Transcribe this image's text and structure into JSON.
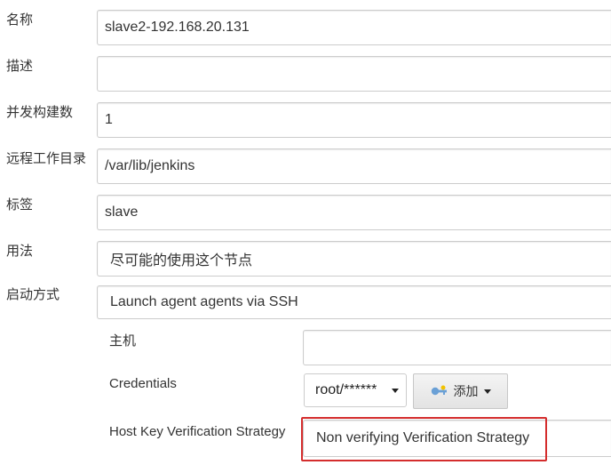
{
  "form": {
    "name": {
      "label": "名称",
      "value": "slave2-192.168.20.131"
    },
    "description": {
      "label": "描述",
      "value": ""
    },
    "executors": {
      "label": "并发构建数",
      "value": "1"
    },
    "remote_dir": {
      "label": "远程工作目录",
      "value": "/var/lib/jenkins"
    },
    "labels": {
      "label": "标签",
      "value": "slave"
    },
    "usage": {
      "label": "用法",
      "value": "尽可能的使用这个节点"
    },
    "launch_method": {
      "label": "启动方式",
      "value": "Launch agent agents via SSH"
    }
  },
  "ssh": {
    "host": {
      "label": "主机",
      "value": ""
    },
    "credentials": {
      "label": "Credentials",
      "value": "root/******",
      "add_label": "添加"
    },
    "host_key": {
      "label": "Host Key Verification Strategy",
      "value": "Non verifying Verification Strategy"
    }
  },
  "colors": {
    "highlight": "#d42d2d",
    "border": "#cccccc"
  },
  "icons": {
    "caret": "caret-down-icon",
    "key": "key-icon"
  }
}
